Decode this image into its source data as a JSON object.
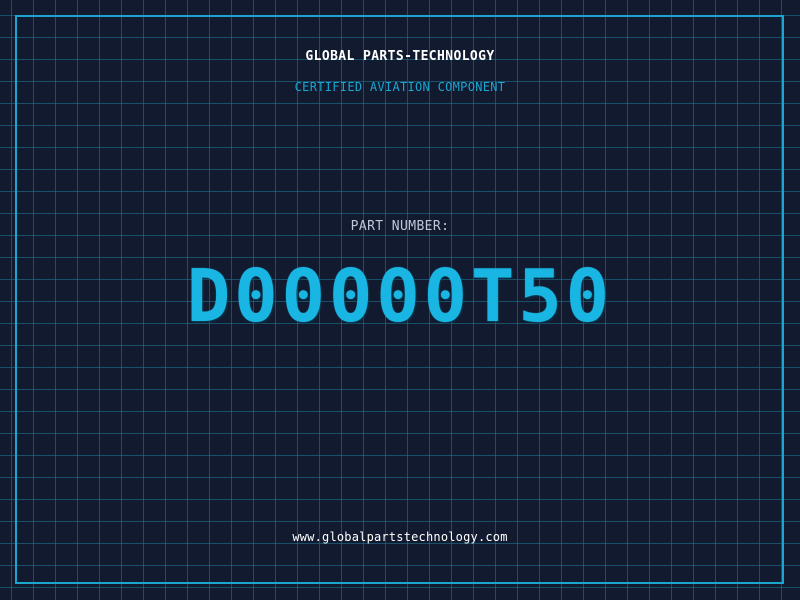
{
  "header": {
    "company": "GLOBAL PARTS-TECHNOLOGY",
    "subtitle": "CERTIFIED AVIATION COMPONENT"
  },
  "part": {
    "label": "PART NUMBER:",
    "number": "D00000T50"
  },
  "footer": {
    "website": "www.globalpartstechnology.com"
  },
  "colors": {
    "background": "#111a2f",
    "grid": "#1f718c",
    "accent": "#1aa6d0",
    "part_number": "#19b6e3"
  }
}
